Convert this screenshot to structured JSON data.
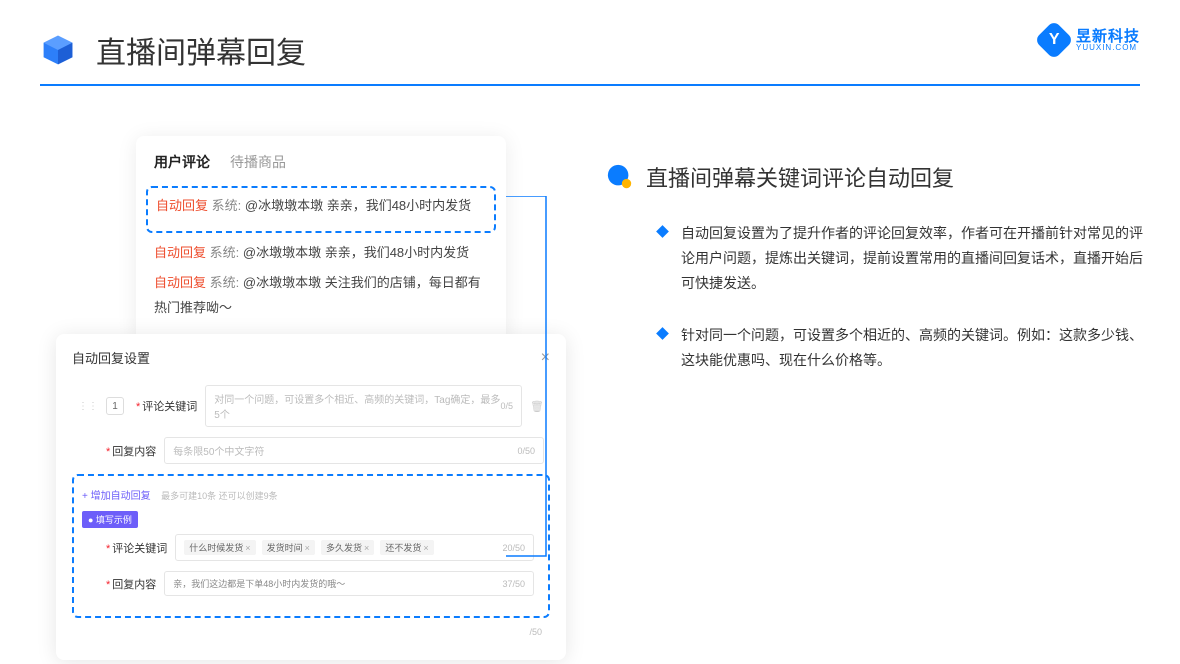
{
  "header": {
    "title": "直播间弹幕回复"
  },
  "brand": {
    "cn": "昱新科技",
    "en": "YUUXIN.COM"
  },
  "card1": {
    "tab_active": "用户评论",
    "tab_inactive": "待播商品",
    "c1_tag": "自动回复",
    "c1_sys": "系统:",
    "c1_text": "@冰墩墩本墩 亲亲，我们48小时内发货",
    "c2_tag": "自动回复",
    "c2_sys": "系统:",
    "c2_text": "@冰墩墩本墩 亲亲，我们48小时内发货",
    "c3_tag": "自动回复",
    "c3_sys": "系统:",
    "c3_text": "@冰墩墩本墩 关注我们的店铺，每日都有热门推荐呦～"
  },
  "card2": {
    "title": "自动回复设置",
    "num": "1",
    "label_keyword": "评论关键词",
    "ph_keyword": "对同一个问题，可设置多个相近、高频的关键词，Tag确定，最多5个",
    "count_keyword": "0/5",
    "label_reply": "回复内容",
    "ph_reply": "每条限50个中文字符",
    "count_reply": "0/50",
    "add_link": "+ 增加自动回复",
    "add_hint": "最多可建10条 还可以创建9条",
    "example_tag": "● 填写示例",
    "ex_label_kw": "评论关键词",
    "chip1": "什么时候发货",
    "chip2": "发货时间",
    "chip3": "多久发货",
    "chip4": "还不发货",
    "ex_count_kw": "20/50",
    "ex_label_reply": "回复内容",
    "ex_reply_text": "亲，我们这边都是下单48小时内发货的哦～",
    "ex_count_reply": "37/50",
    "outer_count": "/50"
  },
  "right": {
    "title": "直播间弹幕关键词评论自动回复",
    "b1": "自动回复设置为了提升作者的评论回复效率，作者可在开播前针对常见的评论用户问题，提炼出关键词，提前设置常用的直播间回复话术，直播开始后可快捷发送。",
    "b2": "针对同一个问题，可设置多个相近的、高频的关键词。例如：这款多少钱、这块能优惠吗、现在什么价格等。"
  }
}
